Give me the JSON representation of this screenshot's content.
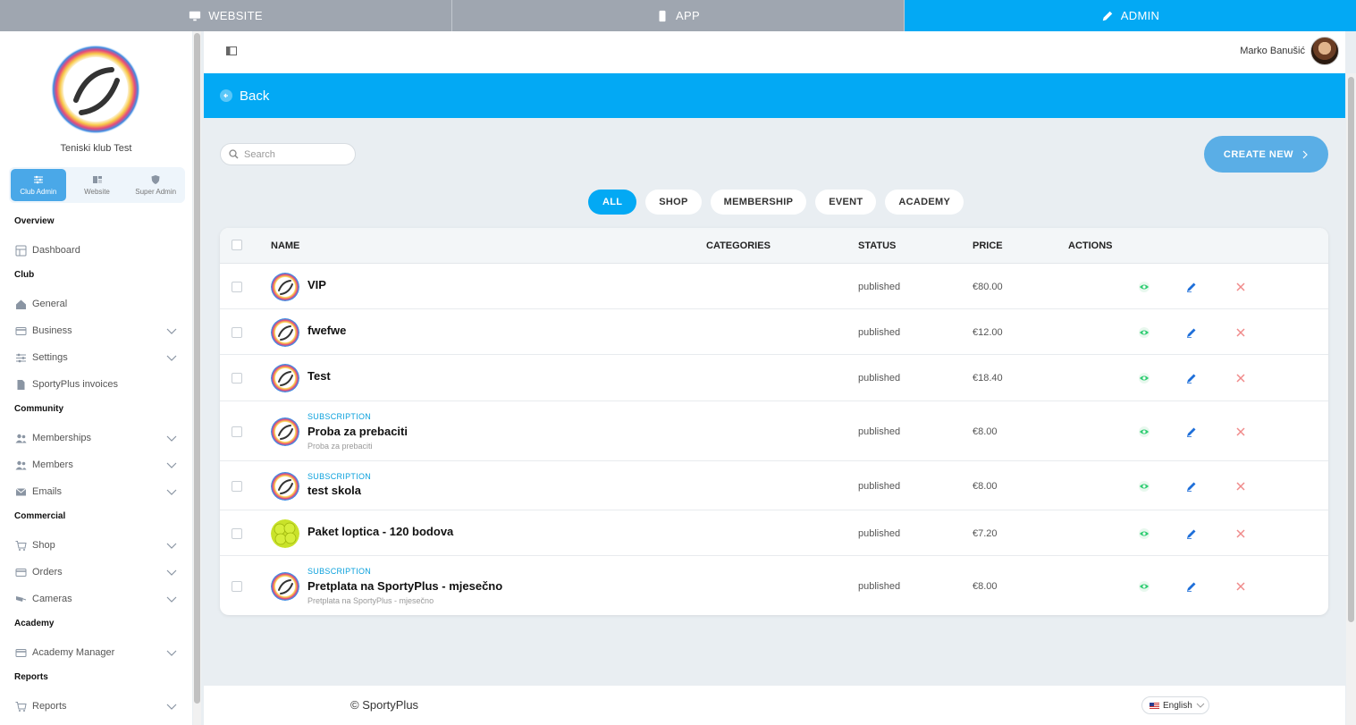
{
  "top_tabs": [
    {
      "label": "WEBSITE",
      "icon": "monitor-icon"
    },
    {
      "label": "APP",
      "icon": "phone-icon"
    },
    {
      "label": "ADMIN",
      "icon": "pencil-icon"
    }
  ],
  "sidebar": {
    "club_name": "Teniski klub Test",
    "roles": [
      {
        "label": "Club Admin",
        "icon": "sliders-icon"
      },
      {
        "label": "Website",
        "icon": "layout-icon"
      },
      {
        "label": "Super Admin",
        "icon": "shield-icon"
      }
    ],
    "sections": [
      {
        "title": "Overview",
        "items": [
          {
            "label": "Dashboard",
            "icon": "dashboard-icon",
            "has_children": false
          }
        ]
      },
      {
        "title": "Club",
        "items": [
          {
            "label": "General",
            "icon": "home-icon",
            "has_children": false
          },
          {
            "label": "Business",
            "icon": "card-icon",
            "has_children": true
          },
          {
            "label": "Settings",
            "icon": "sliders-icon",
            "has_children": true
          },
          {
            "label": "SportyPlus invoices",
            "icon": "file-icon",
            "has_children": false
          }
        ]
      },
      {
        "title": "Community",
        "items": [
          {
            "label": "Memberships",
            "icon": "users-icon",
            "has_children": true
          },
          {
            "label": "Members",
            "icon": "users-icon",
            "has_children": true
          },
          {
            "label": "Emails",
            "icon": "mail-icon",
            "has_children": true
          }
        ]
      },
      {
        "title": "Commercial",
        "items": [
          {
            "label": "Shop",
            "icon": "cart-icon",
            "has_children": true
          },
          {
            "label": "Orders",
            "icon": "card-icon",
            "has_children": true
          },
          {
            "label": "Cameras",
            "icon": "camera-icon",
            "has_children": true
          }
        ]
      },
      {
        "title": "Academy",
        "items": [
          {
            "label": "Academy Manager",
            "icon": "card-icon",
            "has_children": true
          }
        ]
      },
      {
        "title": "Reports",
        "items": [
          {
            "label": "Reports",
            "icon": "cart-icon",
            "has_children": true
          }
        ]
      }
    ]
  },
  "header": {
    "user_name": "Marko Banušić"
  },
  "back_bar": {
    "label": "Back"
  },
  "search": {
    "placeholder": "Search"
  },
  "create_button": {
    "label": "CREATE NEW"
  },
  "filters": [
    {
      "label": "ALL",
      "active": true
    },
    {
      "label": "SHOP",
      "active": false
    },
    {
      "label": "MEMBERSHIP",
      "active": false
    },
    {
      "label": "EVENT",
      "active": false
    },
    {
      "label": "ACADEMY",
      "active": false
    }
  ],
  "table": {
    "columns": {
      "name": "NAME",
      "categories": "CATEGORIES",
      "status": "STATUS",
      "price": "PRICE",
      "actions": "ACTIONS"
    },
    "rows": [
      {
        "name": "VIP",
        "category": "",
        "description": "",
        "status": "published",
        "price": "€80.00",
        "image": "tennis-logo"
      },
      {
        "name": "fwefwe",
        "category": "",
        "description": "",
        "status": "published",
        "price": "€12.00",
        "image": "tennis-logo"
      },
      {
        "name": "Test",
        "category": "",
        "description": "",
        "status": "published",
        "price": "€18.40",
        "image": "tennis-logo"
      },
      {
        "name": "Proba za prebaciti",
        "category": "SUBSCRIPTION",
        "description": "Proba za prebaciti",
        "status": "published",
        "price": "€8.00",
        "image": "tennis-logo"
      },
      {
        "name": "test skola",
        "category": "SUBSCRIPTION",
        "description": "",
        "status": "published",
        "price": "€8.00",
        "image": "tennis-logo"
      },
      {
        "name": "Paket loptica - 120 bodova",
        "category": "",
        "description": "",
        "status": "published",
        "price": "€7.20",
        "image": "tennis-balls"
      },
      {
        "name": "Pretplata na SportyPlus - mjesečno",
        "category": "SUBSCRIPTION",
        "description": "Pretplata na SportyPlus - mjesečno",
        "status": "published",
        "price": "€8.00",
        "image": "tennis-logo"
      }
    ]
  },
  "footer": {
    "copyright": "© SportyPlus",
    "language": "English"
  },
  "colors": {
    "accent": "#03a9f4",
    "view": "#2ecc71",
    "edit": "#1e6fd9",
    "delete": "#f08a8a"
  }
}
